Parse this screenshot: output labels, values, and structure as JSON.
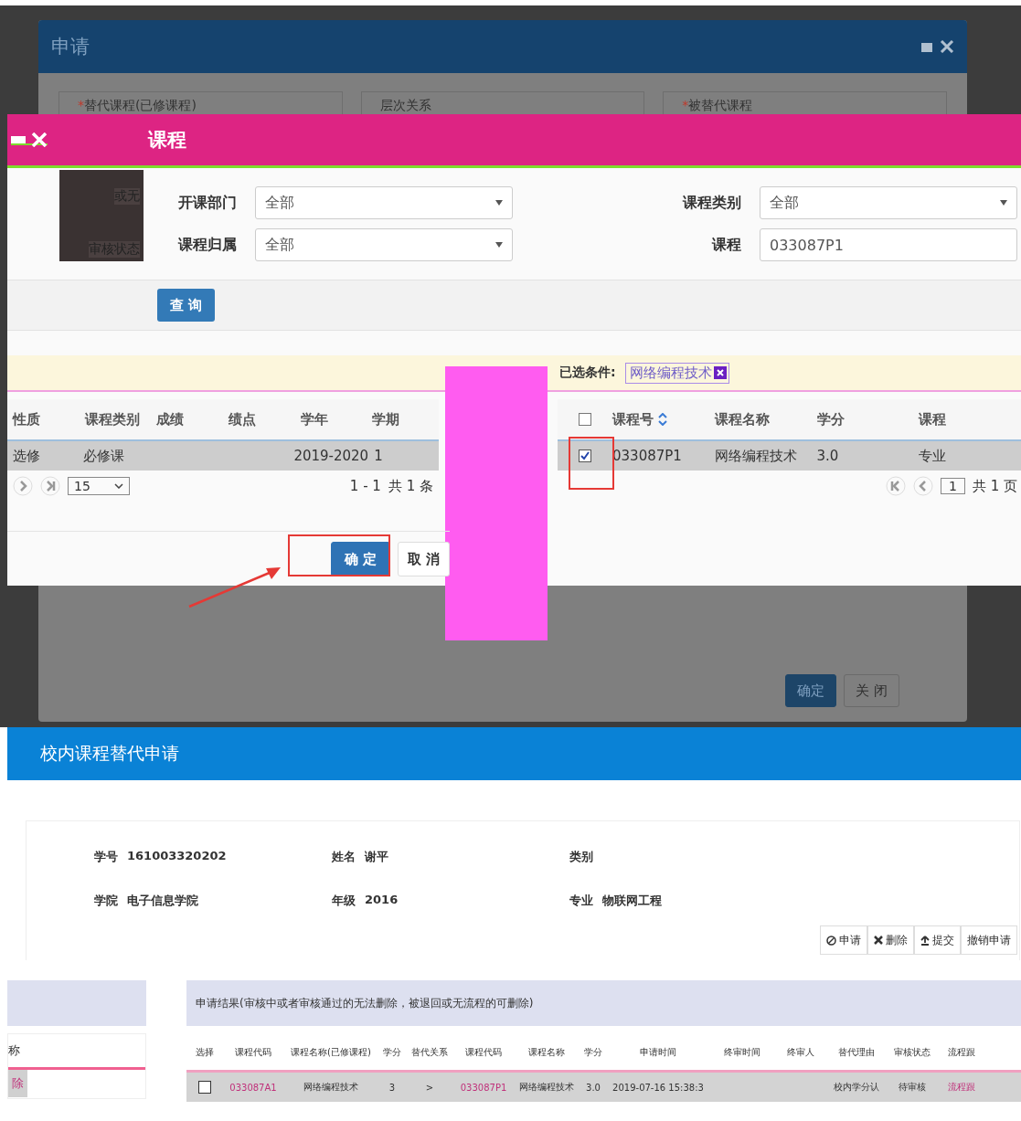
{
  "back_dialog": {
    "title": "申请",
    "fields": [
      {
        "mark": "*",
        "label": "替代课程(已修课程)"
      },
      {
        "label": "层次关系"
      },
      {
        "mark": "*",
        "label": "被替代课程"
      }
    ],
    "side_texts": [
      "或无",
      "审核状态"
    ],
    "buttons": [
      "确定",
      "关 闭"
    ]
  },
  "course_dialog": {
    "title": "课程",
    "filters": [
      {
        "label": "开课部门",
        "value": "全部",
        "kind": "select"
      },
      {
        "label": "课程类别",
        "value": "全部",
        "kind": "select"
      },
      {
        "label": "课程归属",
        "value": "全部",
        "kind": "select"
      },
      {
        "label": "课程",
        "value": "033087P1",
        "kind": "text"
      }
    ],
    "query_button": "查 询",
    "selected_label": "已选条件:",
    "selected_tag": "网络编程技术",
    "left_table": {
      "columns": [
        "性质",
        "课程类别",
        "成绩",
        "绩点",
        "学年",
        "学期"
      ],
      "rows": [
        [
          "选修",
          "必修课",
          "",
          "",
          "2019-2020",
          "1"
        ]
      ],
      "page_size": "15",
      "range": "1 - 1",
      "total": "共 1 条"
    },
    "right_table": {
      "header_checked": false,
      "columns": [
        "课程号",
        "课程名称",
        "学分",
        "课程"
      ],
      "rows": [
        {
          "checked": true,
          "cells": [
            "033087P1",
            "网络编程技术",
            "3.0",
            "专业"
          ]
        }
      ],
      "page": "1",
      "total": "共 1 页"
    },
    "buttons": [
      "确 定",
      "取 消"
    ]
  },
  "page": {
    "title": "校内课程替代申请",
    "info": [
      {
        "label": "学号",
        "value": "161003320202"
      },
      {
        "label": "姓名",
        "value": "谢平"
      },
      {
        "label": "类别"
      },
      {
        "label": "学院",
        "value": "电子信息学院"
      },
      {
        "label": "年级",
        "value": "2016"
      },
      {
        "label": "专业",
        "value": "物联网工程"
      }
    ],
    "toolbar": [
      {
        "kind": "apply",
        "label": "申请"
      },
      {
        "kind": "delete",
        "label": "删除"
      },
      {
        "kind": "submit",
        "label": "提交"
      },
      {
        "kind": "revoke",
        "label": "撤销申请"
      }
    ],
    "left_panel": {
      "column": "称",
      "cell": "除"
    },
    "note": "申请结果(审核中或者审核通过的无法删除，被退回或无流程的可删除)",
    "select_label": "选择",
    "columns": [
      "课程代码",
      "课程名称(已修课程)",
      "学分",
      "替代关系",
      "课程代码",
      "课程名称",
      "学分",
      "申请时间",
      "终审时间",
      "终审人",
      "替代理由",
      "审核状态",
      "流程跟"
    ],
    "rows": [
      {
        "checked": false,
        "cells": [
          "033087A1",
          "网络编程技术",
          "3",
          ">",
          "033087P1",
          "网络编程技术",
          "3.0",
          "2019-07-16 15:38:3",
          "",
          "",
          "校内学分认",
          "待审核",
          "流程跟"
        ]
      }
    ]
  }
}
